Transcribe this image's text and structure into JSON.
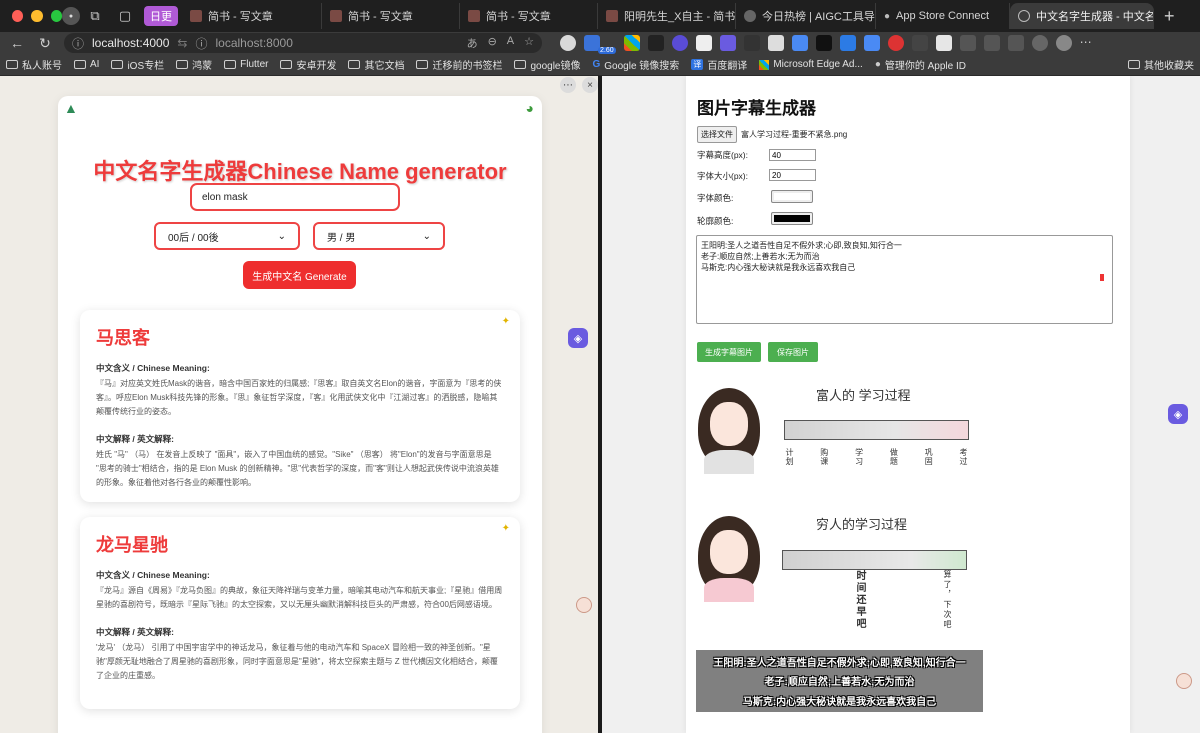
{
  "browser": {
    "group_label": "日更",
    "tabs": [
      {
        "title": "简书 - 写文章",
        "icon": "jianshu-icon"
      },
      {
        "title": "简书 - 写文章",
        "icon": "jianshu-icon"
      },
      {
        "title": "简书 - 写文章",
        "icon": "jianshu-icon"
      },
      {
        "title": "阳明先生_X自主 - 简书",
        "icon": "jianshu-icon"
      },
      {
        "title": "今日热榜 | AIGC工具导航",
        "icon": "github-icon"
      },
      {
        "title": "App Store Connect",
        "icon": "apple-icon"
      },
      {
        "title": "中文名字生成器 - 中文名字",
        "icon": "globe-icon",
        "active": true
      }
    ],
    "address_primary": "localhost:4000",
    "address_secondary": "localhost:8000",
    "ext_badge": "2.60",
    "bookmarks": [
      "私人账号",
      "AI",
      "iOS专栏",
      "鸿蒙",
      "Flutter",
      "安卓开发",
      "其它文档",
      "迁移前的书签栏",
      "google镜像",
      "Google 镜像搜索",
      "百度翻译",
      "Microsoft Edge Ad...",
      "管理你的 Apple ID"
    ],
    "bookmarks_other": "其他收藏夹"
  },
  "left": {
    "title": "中文名字生成器Chinese Name generator",
    "name_value": "elon mask",
    "era_select": "00后 / 00後",
    "gender_select": "男 / 男",
    "generate_label": "生成中文名 Generate",
    "results": [
      {
        "name": "马思客",
        "meaning_heading": "中文含义 / Chinese Meaning:",
        "meaning": "『马』对应英文姓氏Mask的谐音，暗含中国百家姓的归属感;『思客』取自英文名Elon的谐音，字面意为『思考的侠客』。呼应Elon Musk科技先锋的形象。『思』象征哲学深度，『客』化用武侠文化中『江湖过客』的洒脱感，隐喻其颠覆传统行业的姿态。",
        "explain_heading": "中文解释 / 英文解释:",
        "explain": "姓氏 \"马\" （马） 在发音上反映了 \"面具\"，嵌入了中国血统的感觉。\"Sike\" （思客） 将\"Elon\"的发音与字面意思是 \"思考的骑士\"相结合，指的是 Elon Musk 的创新精神。\"思\"代表哲学的深度，而\"客\"则让人想起武侠传说中流浪英雄的形象。象征着他对各行各业的颠覆性影响。"
      },
      {
        "name": "龙马星驰",
        "meaning_heading": "中文含义 / Chinese Meaning:",
        "meaning": "『龙马』源自《周易》『龙马负图』的典故，象征天降祥瑞与变革力量，暗喻其电动汽车和航天事业;『星驰』借用周星驰的喜剧符号，既暗示『星际飞驰』的太空探索，又以无厘头幽默消解科技巨头的严肃感，符合00后网感语境。",
        "explain_heading": "中文解释 / 英文解释:",
        "explain": "'龙马' （龙马） 引用了中国宇宙学中的神话龙马，象征着与他的电动汽车和 SpaceX 冒险相一致的神圣创新。\"星驰\"厚颜无耻地融合了周星驰的喜剧形象，同时字面意思是\"星驰\"，将太空探索主题与 Z 世代横因文化相结合，颠覆了企业的庄重感。"
      }
    ]
  },
  "right": {
    "title": "图片字幕生成器",
    "file_button": "选择文件",
    "file_name": "富人学习过程-重要不紧急.png",
    "subtitle_height_label": "字幕高度(px):",
    "subtitle_height": "40",
    "font_size_label": "字体大小(px):",
    "font_size": "20",
    "font_color_label": "字体颜色:",
    "font_color": "#ffffff",
    "outline_color_label": "轮廓颜色:",
    "outline_color": "#000000",
    "text_lines": [
      "王阳明:圣人之道吾性自足不假外求;心即,致良知,知行合一",
      "老子:顺应自然;上善若水;无为而治",
      "马斯克:内心强大秘诀就是我永远喜欢我自己"
    ],
    "btn_generate": "生成字幕图片",
    "btn_save": "保存图片",
    "preview": {
      "title_rich": "富人的 学习过程",
      "title_poor": "穷人的学习过程",
      "steps": [
        "计划",
        "购课",
        "学习",
        "做题",
        "巩固",
        "考过"
      ],
      "poor_vertical_1": "时间还早吧",
      "poor_vertical_2": "算了，下次吧",
      "subtitles": [
        "王阳明:圣人之道吾性自足不假外求;心即,致良知,知行合一",
        "老子:顺应自然;上善若水;无为而治",
        "马斯克:内心强大秘诀就是我永远喜欢我自己"
      ]
    }
  }
}
